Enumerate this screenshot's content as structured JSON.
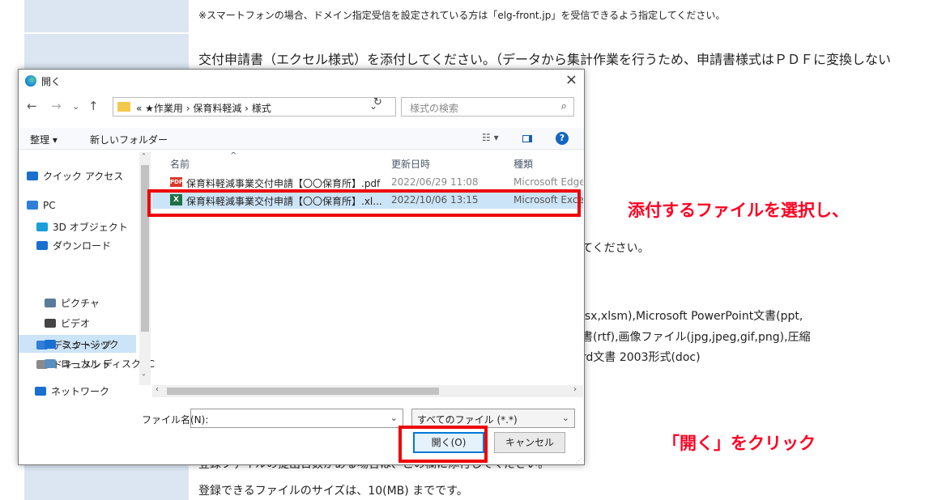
{
  "background": {
    "notice": "※スマートフォンの場合、ドメイン指定受信を設定されている方は「elg-front.jp」を受信できるよう指定してください。",
    "main_line": "交付申請書（エクセル様式）を添付してください。（データから集計作業を行うため、申請書様式はＰＤＦに変換しない",
    "fragment_1": "てください。",
    "fragment_2": "lsx,xlsm),Microsoft PowerPoint文書(ppt,",
    "fragment_3": "書(rtf),画像ファイル(jpg,jpeg,gif,png),圧縮",
    "fragment_4": "rd文書 2003形式(doc)",
    "bottom_1": "登録ファイルの提出日数がある場合は、この欄に添付してください。",
    "bottom_2": "登録できるファイルのサイズは、10(MB) までです。"
  },
  "annotations": {
    "select_file": "添付するファイルを選択し、",
    "click_open": "「開く」をクリック",
    "color": "#ff0022"
  },
  "dialog": {
    "title": "開く",
    "close": "×",
    "nav": {
      "back": "←",
      "forward": "→",
      "dropdown": "⌄",
      "up": "↑"
    },
    "address": {
      "prefix": "«",
      "crumbs": "★作業用 › 保育料軽減 › 様式",
      "dropdown": "⌄",
      "refresh": "↻"
    },
    "search": {
      "placeholder": "様式の検索",
      "icon": "⌕"
    },
    "commands": {
      "organize": "整理 ▾",
      "new_folder": "新しいフォルダー",
      "view": "☷ ▾",
      "help": "?"
    },
    "nav_pane": [
      {
        "label": "クイック アクセス",
        "icon": "star-icon",
        "color": "#1a6fd0"
      },
      {
        "label": "PC",
        "icon": "pc-icon",
        "color": "#2f7fd8"
      },
      {
        "label": "3D オブジェクト",
        "icon": "cube-icon",
        "color": "#1aa0d8"
      },
      {
        "label": "ダウンロード",
        "icon": "download-icon",
        "color": "#1a6fd0"
      },
      {
        "label": "デスクトップ",
        "icon": "desktop-icon",
        "color": "#2f7fd8"
      },
      {
        "label": "ドキュメント",
        "icon": "document-icon",
        "color": "#8a8a8a"
      },
      {
        "label": "ピクチャ",
        "icon": "pictures-icon",
        "color": "#5a7a9a"
      },
      {
        "label": "ビデオ",
        "icon": "video-icon",
        "color": "#444"
      },
      {
        "label": "ミュージック",
        "icon": "music-icon",
        "color": "#1a6fd0"
      },
      {
        "label": "ローカル ディスク (C",
        "icon": "disk-icon",
        "color": "#5a8fc0"
      },
      {
        "label": "ネットワーク",
        "icon": "network-icon",
        "color": "#1a6fd0"
      }
    ],
    "columns": {
      "name": "名前",
      "date": "更新日時",
      "type": "種類"
    },
    "files": [
      {
        "icon": "PDF",
        "name": "保育料軽減事業交付申請【〇〇保育所】.pdf",
        "date": "2022/06/29 11:08",
        "type": "Microsoft Edge"
      },
      {
        "icon": "X",
        "name": "保育料軽減事業交付申請【〇〇保育所】.xl...",
        "date": "2022/10/06 13:15",
        "type": "Microsoft Excel"
      }
    ],
    "filename_label": "ファイル名(N):",
    "filename_value": "",
    "filetype": "すべてのファイル (*.*)",
    "open_button": "開く(O)",
    "cancel_button": "キャンセル"
  }
}
